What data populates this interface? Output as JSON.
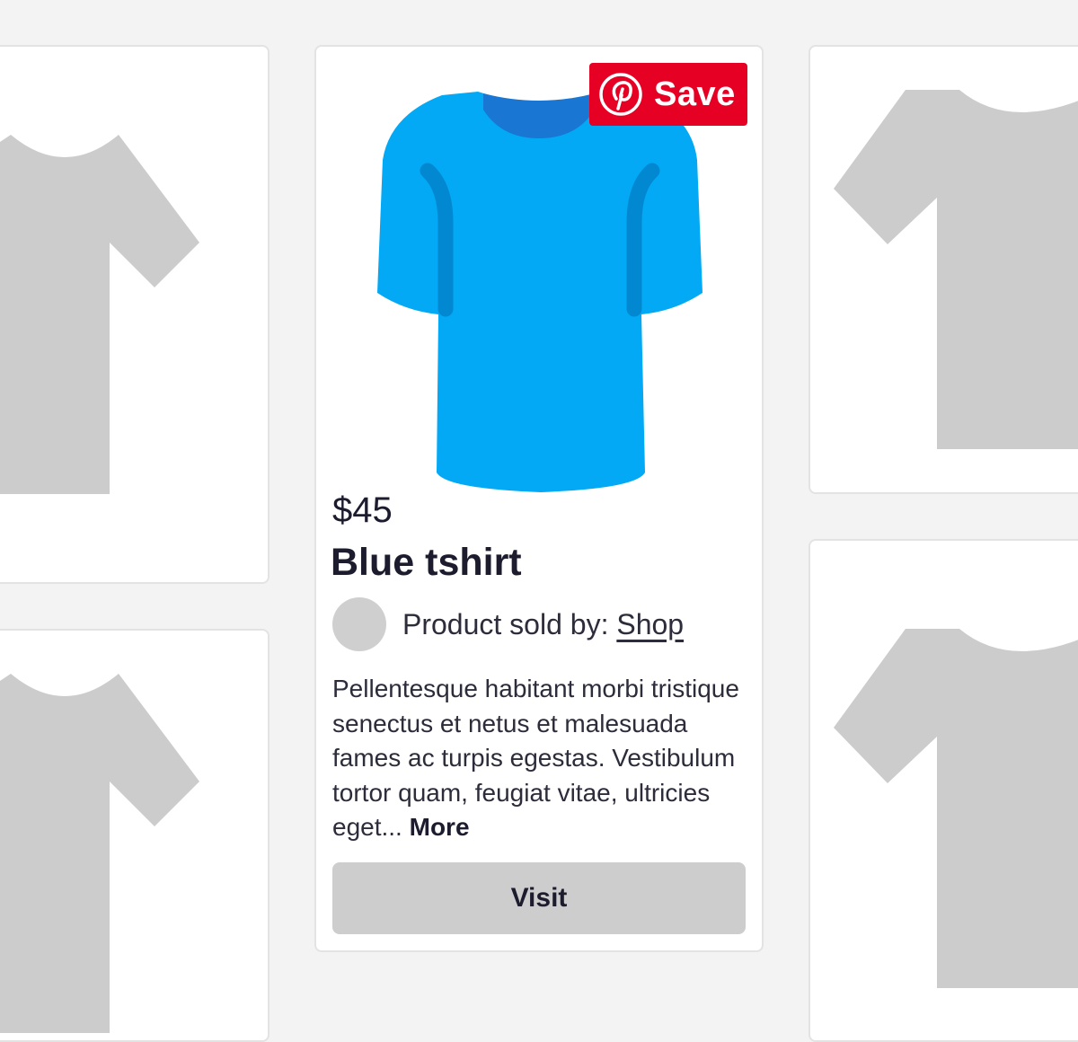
{
  "colors": {
    "background": "#f3f3f3",
    "card": "#ffffff",
    "placeholder": "#cccccc",
    "tshirt": "#03a9f4",
    "tshirt_shade": "#0288d1",
    "collar": "#1976d2",
    "save_red": "#e60023",
    "button_gray": "#cdcdcd",
    "text_dark": "#1c1c2e"
  },
  "product": {
    "image_icon": "tshirt-icon",
    "price": "$45",
    "title": "Blue tshirt",
    "seller_prefix": "Product sold by: ",
    "seller_link": "Shop",
    "description": "Pellentesque habitant morbi tristique senectus et netus et malesuada fames ac turpis egestas. Vestibulum tortor quam, feugiat vitae, ultricies eget...",
    "more_label": "More",
    "visit_label": "Visit"
  },
  "save_button": {
    "icon": "pinterest-icon",
    "label": "Save"
  },
  "placeholder_cards": [
    {
      "icon": "tshirt-placeholder-icon"
    },
    {
      "icon": "tshirt-placeholder-icon"
    },
    {
      "icon": "tshirt-placeholder-icon"
    },
    {
      "icon": "tshirt-placeholder-icon"
    }
  ]
}
